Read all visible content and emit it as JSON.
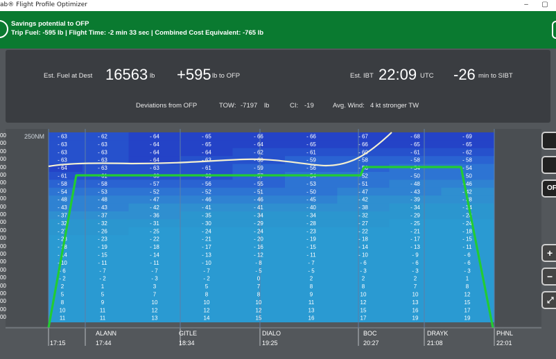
{
  "window": {
    "title": "ab® Flight Profile Optimizer",
    "minimize_glyph": "–",
    "maximize_glyph": "▢"
  },
  "banner": {
    "title": "Savings potential to OFP",
    "summary": "Trip Fuel: -595 lb | Flight Time: -2 min 33 sec | Combined Cost Equivalent: -765 lb",
    "color": "#0a7a30"
  },
  "summary": {
    "fuel_label": "Est. Fuel at Dest",
    "fuel_value": "16563",
    "fuel_unit": "lb",
    "fuel_delta": "+595",
    "fuel_delta_suffix": "lb to OFP",
    "ibt_label": "Est. IBT",
    "ibt_value": "22:09",
    "ibt_unit": "UTC",
    "sibt_delta": "-26",
    "sibt_suffix": "min to SIBT",
    "deviations_label": "Deviations from OFP",
    "tow_label": "TOW:",
    "tow_value": "-7197",
    "tow_unit": "lb",
    "ci_label": "CI:",
    "ci_value": "-19",
    "wind_label": "Avg. Wind:",
    "wind_value": "4 kt stronger TW"
  },
  "chart": {
    "scale_label": "250NM",
    "y_tick_labels": [
      "00",
      "00",
      "00",
      "00",
      "00",
      "00",
      "00",
      "00",
      "00",
      "00",
      "00",
      "00",
      "00",
      "00",
      "00",
      "00",
      "00",
      "00",
      "00",
      "00",
      "00",
      "00",
      "00",
      "00"
    ],
    "columns": [
      {
        "values": [
          -63,
          -63,
          -63,
          -63,
          -64,
          -61,
          -58,
          -54,
          -48,
          -43,
          -37,
          -32,
          -27,
          -23,
          -18,
          -14,
          -10,
          -6,
          -2,
          2,
          5,
          8,
          10,
          11
        ]
      },
      {
        "values": [
          -62,
          -63,
          -63,
          -63,
          -63,
          -61,
          -58,
          -53,
          -48,
          -43,
          -37,
          -32,
          -26,
          -23,
          -19,
          -15,
          -11,
          -7,
          -2,
          1,
          5,
          9,
          11,
          11
        ]
      },
      {
        "values": [
          -64,
          -64,
          -64,
          -64,
          -63,
          -60,
          -57,
          -52,
          -47,
          -42,
          -36,
          -31,
          -25,
          -22,
          -18,
          -14,
          -11,
          -7,
          -3,
          3,
          7,
          10,
          12,
          13
        ]
      },
      {
        "values": [
          -65,
          -65,
          -64,
          -63,
          -61,
          -60,
          -56,
          -52,
          -46,
          -41,
          -35,
          -30,
          -24,
          -21,
          -17,
          -13,
          -10,
          -7,
          -2,
          5,
          8,
          10,
          12,
          14
        ]
      },
      {
        "values": [
          -66,
          -64,
          -62,
          -60,
          -59,
          -57,
          -55,
          -51,
          -46,
          -41,
          -34,
          -29,
          -24,
          -20,
          -16,
          -12,
          -8,
          -5,
          0,
          7,
          8,
          10,
          12,
          15
        ]
      },
      {
        "values": [
          -66,
          -65,
          -61,
          -59,
          -56,
          -54,
          -53,
          -50,
          -45,
          -40,
          -34,
          -28,
          -23,
          -19,
          -15,
          -11,
          -7,
          -5,
          2,
          8,
          9,
          11,
          13,
          16
        ]
      },
      {
        "values": [
          -67,
          -66,
          -60,
          -58,
          -56,
          -52,
          -51,
          -47,
          -42,
          -38,
          -32,
          -27,
          -22,
          -18,
          -14,
          -10,
          -6,
          -3,
          2,
          8,
          10,
          12,
          15,
          17
        ]
      },
      {
        "values": [
          -68,
          -65,
          -61,
          -58,
          -54,
          -50,
          -48,
          -43,
          -39,
          -34,
          -29,
          -25,
          -21,
          -17,
          -13,
          -9,
          -6,
          -3,
          2,
          7,
          10,
          13,
          16,
          19
        ]
      },
      {
        "values": [
          -69,
          -65,
          -62,
          -58,
          -54,
          -50,
          -46,
          -42,
          -38,
          -34,
          -28,
          -24,
          -18,
          -15,
          -11,
          -6,
          -6,
          -3,
          1,
          8,
          12,
          15,
          17,
          19
        ]
      }
    ],
    "waypoints": [
      {
        "name": "",
        "time": "17:15"
      },
      {
        "name": "ALANN",
        "time": "17:44"
      },
      {
        "name": "GITLE",
        "time": "18:34"
      },
      {
        "name": "DIALO",
        "time": "19:25"
      },
      {
        "name": "BOC",
        "time": "20:27"
      },
      {
        "name": "DRAYK",
        "time": "21:08"
      },
      {
        "name": "PHNL",
        "time": "22:01"
      }
    ],
    "profile_color": "#22cc33",
    "optimum_color": "#f4f0d0"
  },
  "side_buttons": {
    "ofp_label": "OF",
    "plus_label": "+",
    "minus_label": "−",
    "fit_label": "⤢"
  }
}
